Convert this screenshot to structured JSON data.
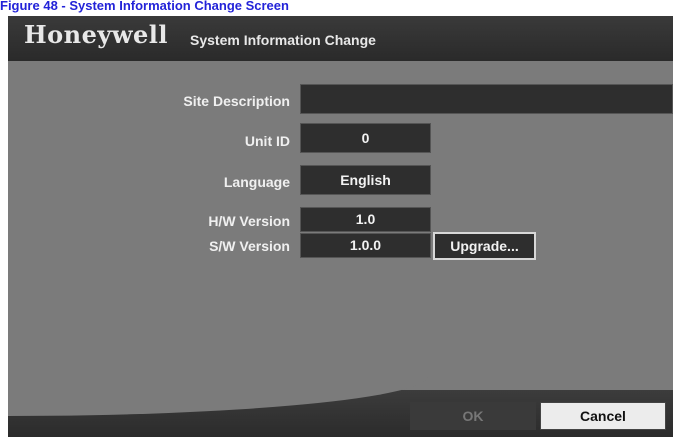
{
  "caption": "Figure 48 - System Information Change Screen",
  "window": {
    "brand": "Honeywell",
    "title": "System Information Change"
  },
  "fields": {
    "site_description": {
      "label": "Site Description",
      "value": ""
    },
    "unit_id": {
      "label": "Unit ID",
      "value": "0"
    },
    "language": {
      "label": "Language",
      "value": "English"
    },
    "hw_version": {
      "label": "H/W Version",
      "value": "1.0"
    },
    "sw_version": {
      "label": "S/W Version",
      "value": "1.0.0"
    }
  },
  "buttons": {
    "upgrade": "Upgrade...",
    "ok": "OK",
    "cancel": "Cancel"
  }
}
